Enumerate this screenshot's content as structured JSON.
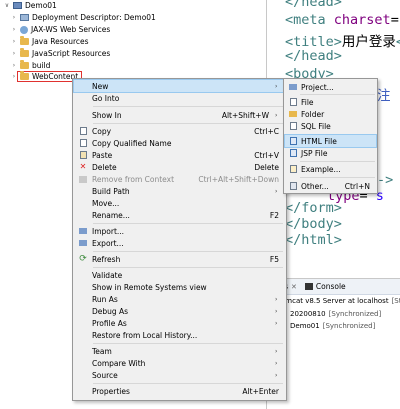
{
  "tree": {
    "items": [
      {
        "label": "Demo01",
        "twisty": "∨",
        "icon": "project"
      },
      {
        "label": "Deployment Descriptor: Demo01",
        "twisty": "›",
        "icon": "descriptor"
      },
      {
        "label": "JAX-WS Web Services",
        "twisty": "›",
        "icon": "webservice"
      },
      {
        "label": "Java Resources",
        "twisty": "›",
        "icon": "java"
      },
      {
        "label": "JavaScript Resources",
        "twisty": "›",
        "icon": "js"
      },
      {
        "label": "build",
        "twisty": "›",
        "icon": "folder"
      },
      {
        "label": "WebContent",
        "twisty": "›",
        "icon": "folder"
      }
    ]
  },
  "editor": {
    "line0": "</head>",
    "meta_open": "<meta ",
    "meta_attr": "charset",
    "meta_eq": "=",
    "meta_val": "\"U",
    "title_open": "<title>",
    "title_text": "用户登录",
    "title_close": "</",
    "head_close": "</head>",
    "body_open": "<body>",
    "comment": "注",
    "ype1": "ype",
    "ype2": "ype",
    "arrow_line": "->",
    "input_attr": "type",
    "input_eq": "=",
    "input_val": "\"s",
    "form_close": "</form>",
    "body_close": "</body>",
    "html_close": "</html>"
  },
  "servers": {
    "tab1_label": "rs",
    "tab2_label": "Console",
    "rows": [
      {
        "label": "omcat v8.5 Server at localhost",
        "status": "[Sta"
      },
      {
        "label": "20200810",
        "status": "[Synchronized]"
      },
      {
        "label": "Demo01",
        "status": "[Synchronized]"
      }
    ]
  },
  "context_menu": {
    "items": [
      {
        "label": "New",
        "shortcut": "",
        "submenu": true,
        "active": true
      },
      {
        "label": "Go Into",
        "shortcut": ""
      },
      {
        "label": "Show In",
        "shortcut": "Alt+Shift+W",
        "submenu": true
      },
      {
        "label": "Copy",
        "shortcut": "Ctrl+C"
      },
      {
        "label": "Copy Qualified Name",
        "shortcut": ""
      },
      {
        "label": "Paste",
        "shortcut": "Ctrl+V"
      },
      {
        "label": "Delete",
        "shortcut": "Delete"
      },
      {
        "label": "Remove from Context",
        "shortcut": "Ctrl+Alt+Shift+Down",
        "disabled": true
      },
      {
        "label": "Build Path",
        "shortcut": "",
        "submenu": true
      },
      {
        "label": "Move...",
        "shortcut": ""
      },
      {
        "label": "Rename...",
        "shortcut": "F2"
      },
      {
        "label": "Import...",
        "shortcut": ""
      },
      {
        "label": "Export...",
        "shortcut": ""
      },
      {
        "label": "Refresh",
        "shortcut": "F5"
      },
      {
        "label": "Validate",
        "shortcut": ""
      },
      {
        "label": "Show in Remote Systems view",
        "shortcut": ""
      },
      {
        "label": "Run As",
        "shortcut": "",
        "submenu": true
      },
      {
        "label": "Debug As",
        "shortcut": "",
        "submenu": true
      },
      {
        "label": "Profile As",
        "shortcut": "",
        "submenu": true
      },
      {
        "label": "Restore from Local History...",
        "shortcut": ""
      },
      {
        "label": "Team",
        "shortcut": "",
        "submenu": true
      },
      {
        "label": "Compare With",
        "shortcut": "",
        "submenu": true
      },
      {
        "label": "Source",
        "shortcut": "",
        "submenu": true
      },
      {
        "label": "Properties",
        "shortcut": "Alt+Enter"
      }
    ],
    "submenu_arrow": "›"
  },
  "new_submenu": {
    "items": [
      {
        "label": "Project...",
        "shortcut": ""
      },
      {
        "label": "File",
        "shortcut": ""
      },
      {
        "label": "Folder",
        "shortcut": ""
      },
      {
        "label": "SQL File",
        "shortcut": ""
      },
      {
        "label": "HTML File",
        "shortcut": "",
        "active": true
      },
      {
        "label": "JSP File",
        "shortcut": ""
      },
      {
        "label": "Example...",
        "shortcut": ""
      },
      {
        "label": "Other...",
        "shortcut": "Ctrl+N"
      }
    ]
  },
  "colors": {
    "highlight": "#cce4f7",
    "selection_box": "#e0322f",
    "menu_bg": "#f0f0f0"
  }
}
